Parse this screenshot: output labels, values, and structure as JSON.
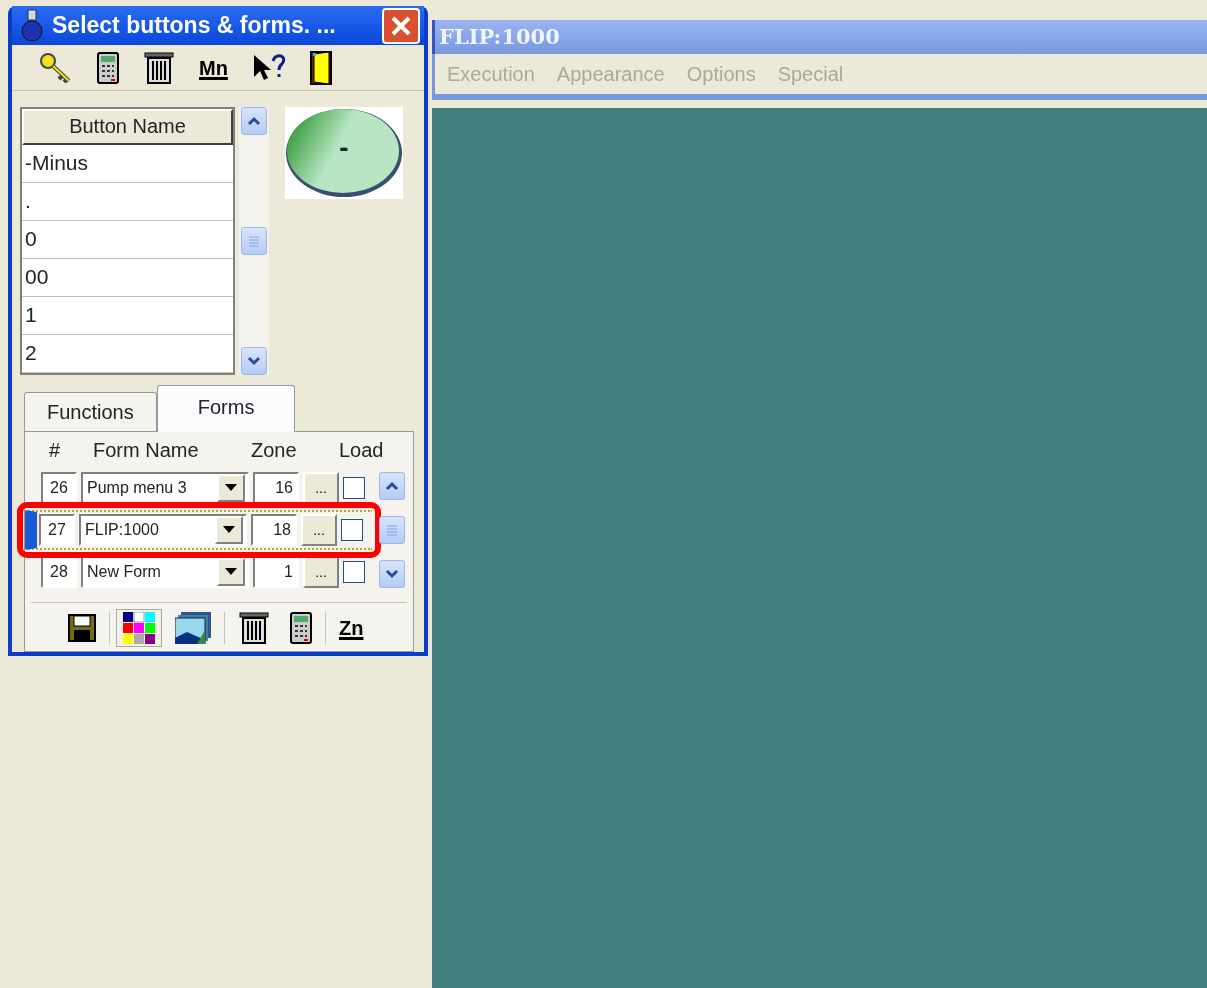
{
  "tool_window": {
    "title": "Select buttons & forms. ...",
    "toolbar": [
      {
        "pressed": false
      },
      {
        "pressed": false
      },
      {
        "pressed": false
      },
      {
        "label": "Mn",
        "pressed": false
      },
      {
        "pressed": false
      },
      {
        "pressed": false
      }
    ],
    "button_list": {
      "column": "Button Name",
      "rows": [
        {
          "name": "-Minus",
          "selected": false
        },
        {
          "name": ".",
          "selected": false
        },
        {
          "name": "0",
          "selected": false
        },
        {
          "name": "00",
          "selected": false
        },
        {
          "name": "1",
          "selected": false
        },
        {
          "name": "2",
          "selected": false
        }
      ]
    },
    "preview_button": {
      "label": "-"
    },
    "tabs": [
      {
        "label": "Functions",
        "selected": false
      },
      {
        "label": "Forms",
        "selected": true
      }
    ],
    "forms_table": {
      "columns": [
        "#",
        "Form Name",
        "Zone",
        "Load"
      ],
      "rows": [
        {
          "number": "26",
          "form_name": "Pump menu 3",
          "zone": "16",
          "button": "...",
          "load": false,
          "selected": false,
          "highlighted": false
        },
        {
          "number": "27",
          "form_name": "FLIP:1000",
          "zone": "18",
          "button": "...",
          "load": false,
          "selected": true,
          "highlighted": true
        },
        {
          "number": "28",
          "form_name": "New Form",
          "zone": "1",
          "button": "...",
          "load": false,
          "selected": false,
          "highlighted": false
        }
      ]
    },
    "bottom_toolbar": [
      {
        "pressed": false
      },
      {
        "pressed": true
      },
      {
        "pressed": false
      },
      {
        "pressed": false
      },
      {
        "pressed": false
      },
      {
        "label": "Zn",
        "pressed": false
      }
    ]
  },
  "main_window": {
    "title": "FLIP:1000",
    "active": false,
    "menu": [
      {
        "label": "Execution",
        "disabled": true
      },
      {
        "label": "Appearance",
        "disabled": true
      },
      {
        "label": "Options",
        "disabled": true
      },
      {
        "label": "Special",
        "disabled": true
      }
    ]
  }
}
